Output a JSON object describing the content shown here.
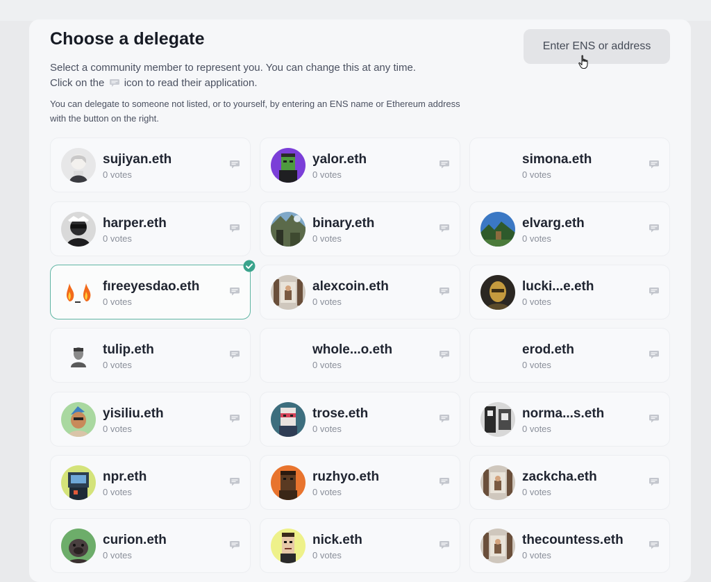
{
  "header": {
    "title": "Choose a delegate",
    "desc_line1": "Select a community member to represent you. You can change this at any time.",
    "desc_line2_pre": "Click on the",
    "desc_line2_post": "icon to read their application.",
    "note": "You can delegate to someone not listed, or to yourself, by entering an ENS name or Ethereum address with the button on the right.",
    "ens_button_label": "Enter ENS or address"
  },
  "delegates": [
    {
      "name": "sujiyan.eth",
      "votes": "0 votes"
    },
    {
      "name": "yalor.eth",
      "votes": "0 votes"
    },
    {
      "name": "simona.eth",
      "votes": "0 votes"
    },
    {
      "name": "harper.eth",
      "votes": "0 votes"
    },
    {
      "name": "binary.eth",
      "votes": "0 votes"
    },
    {
      "name": "elvarg.eth",
      "votes": "0 votes"
    },
    {
      "name": "fıreeyesdao.eth",
      "votes": "0 votes",
      "selected": true
    },
    {
      "name": "alexcoin.eth",
      "votes": "0 votes"
    },
    {
      "name": "lucki...e.eth",
      "votes": "0 votes"
    },
    {
      "name": "tulip.eth",
      "votes": "0 votes"
    },
    {
      "name": "whole...o.eth",
      "votes": "0 votes"
    },
    {
      "name": "erod.eth",
      "votes": "0 votes"
    },
    {
      "name": "yisiliu.eth",
      "votes": "0 votes"
    },
    {
      "name": "trose.eth",
      "votes": "0 votes"
    },
    {
      "name": "norma...s.eth",
      "votes": "0 votes"
    },
    {
      "name": "npr.eth",
      "votes": "0 votes"
    },
    {
      "name": "ruzhyo.eth",
      "votes": "0 votes"
    },
    {
      "name": "zackcha.eth",
      "votes": "0 votes"
    },
    {
      "name": "curion.eth",
      "votes": "0 votes"
    },
    {
      "name": "nick.eth",
      "votes": "0 votes"
    },
    {
      "name": "thecountess.eth",
      "votes": "0 votes"
    }
  ],
  "colors": {
    "selected_border": "#5fb5a3",
    "check_badge": "#3aa38c"
  },
  "icons": {
    "application": "chat-bubble-icon",
    "selected": "check-icon",
    "cursor": "hand-pointer-icon"
  }
}
